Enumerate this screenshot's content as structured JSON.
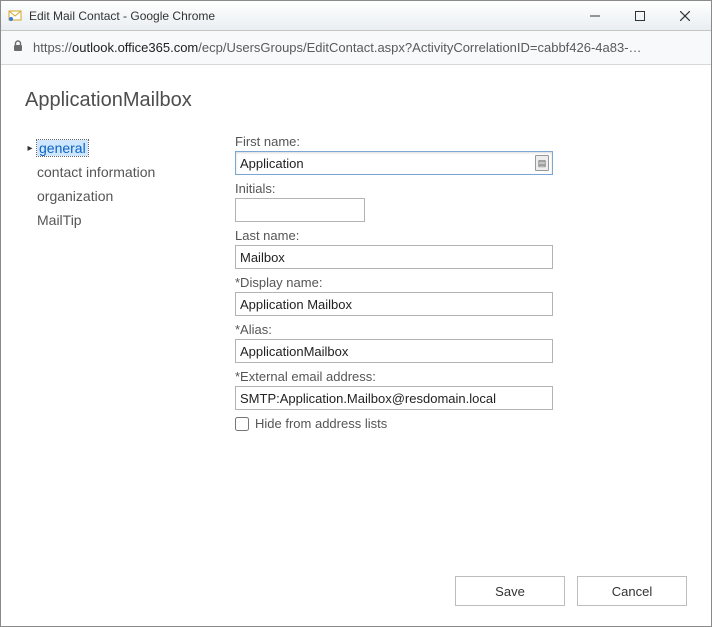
{
  "window": {
    "title": "Edit Mail Contact - Google Chrome"
  },
  "address": {
    "host": "outlook.office365.com",
    "path": "/ecp/UsersGroups/EditContact.aspx?ActivityCorrelationID=cabbf426-4a83-…"
  },
  "page": {
    "title": "ApplicationMailbox"
  },
  "sidebar": {
    "items": [
      {
        "label": "general",
        "selected": true
      },
      {
        "label": "contact information",
        "selected": false
      },
      {
        "label": "organization",
        "selected": false
      },
      {
        "label": "MailTip",
        "selected": false
      }
    ]
  },
  "form": {
    "first_name": {
      "label": "First name:",
      "value": "Application"
    },
    "initials": {
      "label": "Initials:",
      "value": ""
    },
    "last_name": {
      "label": "Last name:",
      "value": "Mailbox"
    },
    "display_name": {
      "label": "*Display name:",
      "value": "Application Mailbox"
    },
    "alias": {
      "label": "*Alias:",
      "value": "ApplicationMailbox"
    },
    "external_email": {
      "label": "*External email address:",
      "value": "SMTP:Application.Mailbox@resdomain.local"
    },
    "hide_from_lists": {
      "label": "Hide from address lists",
      "checked": false
    }
  },
  "buttons": {
    "save": "Save",
    "cancel": "Cancel"
  }
}
